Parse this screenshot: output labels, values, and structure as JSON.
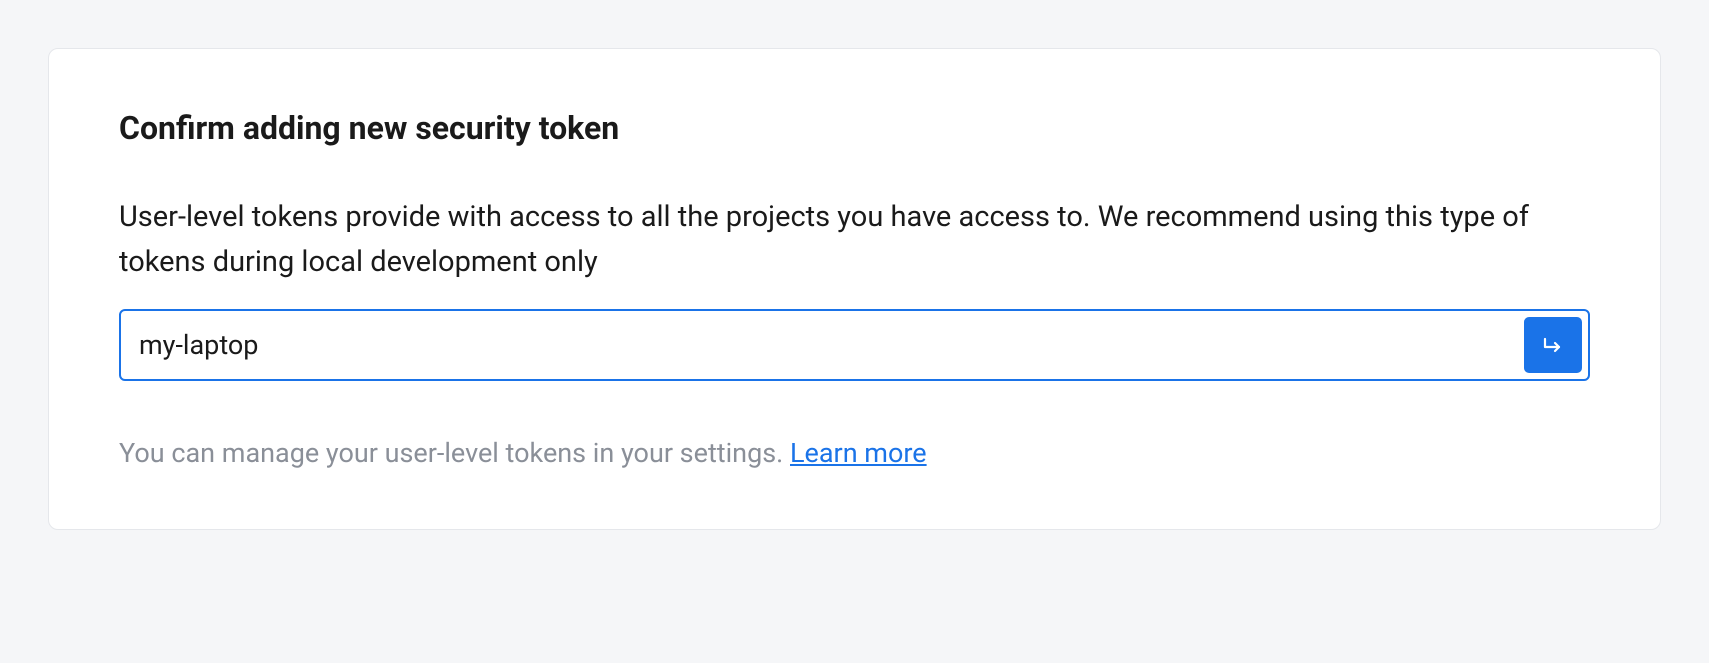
{
  "card": {
    "title": "Confirm adding new security token",
    "description": "User-level tokens provide with access to all the projects you have access to. We recommend using this type of tokens during local development only",
    "input": {
      "value": "my-laptop",
      "placeholder": ""
    },
    "footer": {
      "text": "You can manage your user-level tokens in your settings. ",
      "link_label": "Learn more"
    }
  }
}
